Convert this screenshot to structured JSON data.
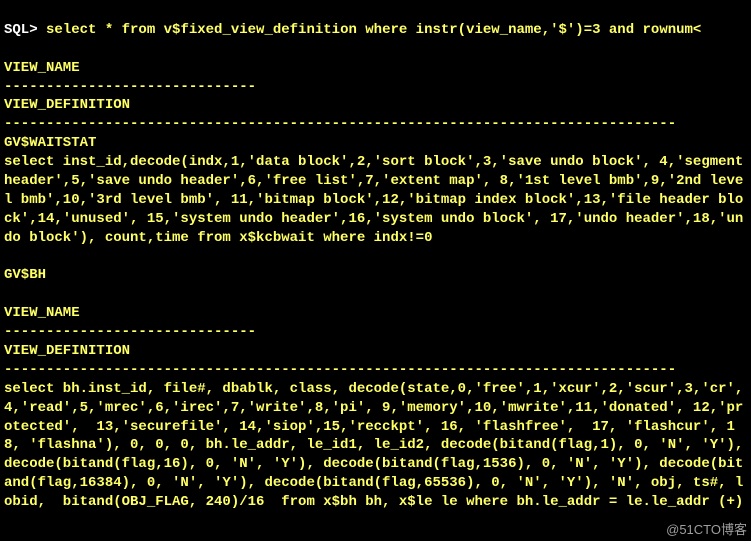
{
  "prompt": "SQL> ",
  "query": "select * from v$fixed_view_definition where instr(view_name,'$')=3 and rownum<",
  "col1_header": "VIEW_NAME",
  "col1_rule": "------------------------------",
  "col2_header": "VIEW_DEFINITION",
  "col2_rule": "--------------------------------------------------------------------------------",
  "rows": [
    {
      "view_name": "GV$WAITSTAT",
      "view_definition": "select inst_id,decode(indx,1,'data block',2,'sort block',3,'save undo block', 4,'segment header',5,'save undo header',6,'free list',7,'extent map', 8,'1st level bmb',9,'2nd level bmb',10,'3rd level bmb', 11,'bitmap block',12,'bitmap index block',13,'file header block',14,'unused', 15,'system undo header',16,'system undo block', 17,'undo header',18,'undo block'), count,time from x$kcbwait where indx!=0"
    },
    {
      "view_name": "GV$BH",
      "view_definition": "select bh.inst_id, file#, dbablk, class, decode(state,0,'free',1,'xcur',2,'scur',3,'cr', 4,'read',5,'mrec',6,'irec',7,'write',8,'pi', 9,'memory',10,'mwrite',11,'donated', 12,'protected',  13,'securefile', 14,'siop',15,'recckpt', 16, 'flashfree',  17, 'flashcur', 18, 'flashna'), 0, 0, 0, bh.le_addr, le_id1, le_id2, decode(bitand(flag,1), 0, 'N', 'Y'), decode(bitand(flag,16), 0, 'N', 'Y'), decode(bitand(flag,1536), 0, 'N', 'Y'), decode(bitand(flag,16384), 0, 'N', 'Y'), decode(bitand(flag,65536), 0, 'N', 'Y'), 'N', obj, ts#, lobid,  bitand(OBJ_FLAG, 240)/16  from x$bh bh, x$le le where bh.le_addr = le.le_addr (+)"
    }
  ],
  "watermark": "@51CTO博客"
}
